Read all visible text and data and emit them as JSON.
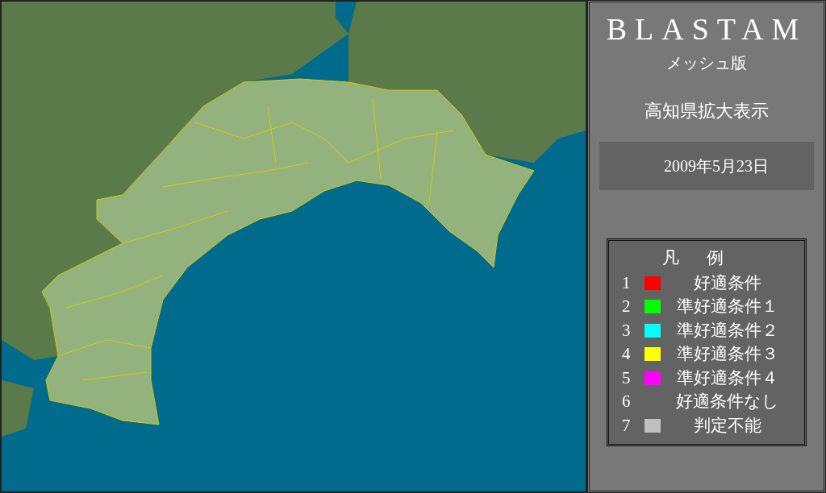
{
  "panel": {
    "title": "BLASTAM",
    "subtitle": "メッシュ版",
    "view_label": "高知県拡大表示",
    "date": "2009年5月23日"
  },
  "legend": {
    "heading": "凡例",
    "items": [
      {
        "number": "1",
        "label": "好適条件",
        "color": "#ff0000"
      },
      {
        "number": "2",
        "label": "準好適条件１",
        "color": "#00ff00"
      },
      {
        "number": "3",
        "label": "準好適条件２",
        "color": "#00ffff"
      },
      {
        "number": "4",
        "label": "準好適条件３",
        "color": "#ffff00"
      },
      {
        "number": "5",
        "label": "準好適条件４",
        "color": "#ff00ff"
      },
      {
        "number": "6",
        "label": "好適条件なし"
      },
      {
        "number": "7",
        "label": "判定不能",
        "color": "#c0c0c0"
      }
    ]
  }
}
